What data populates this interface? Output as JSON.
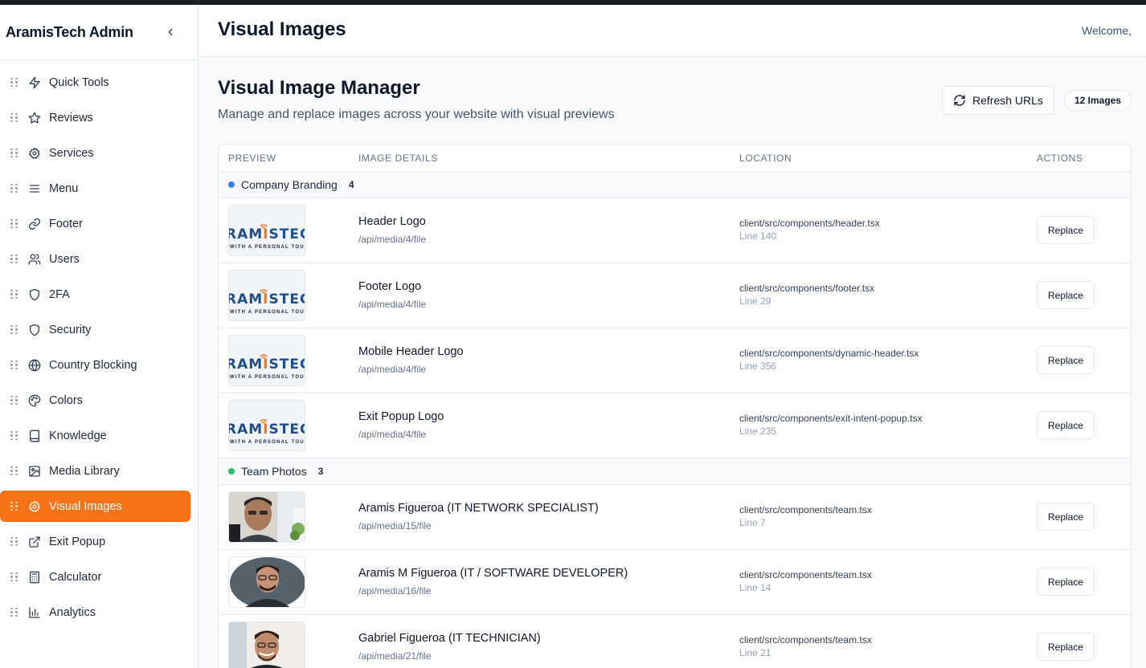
{
  "sidebar": {
    "brand": "AramisTech Admin",
    "collapse_icon": "chevron-left-icon",
    "items": [
      {
        "label": "Quick Tools",
        "icon": "zap-icon"
      },
      {
        "label": "Reviews",
        "icon": "star-icon"
      },
      {
        "label": "Services",
        "icon": "gear-icon"
      },
      {
        "label": "Menu",
        "icon": "menu-icon"
      },
      {
        "label": "Footer",
        "icon": "link-icon"
      },
      {
        "label": "Users",
        "icon": "users-icon"
      },
      {
        "label": "2FA",
        "icon": "shield-icon"
      },
      {
        "label": "Security",
        "icon": "shield-icon"
      },
      {
        "label": "Country Blocking",
        "icon": "globe-icon"
      },
      {
        "label": "Colors",
        "icon": "palette-icon"
      },
      {
        "label": "Knowledge",
        "icon": "book-icon"
      },
      {
        "label": "Media Library",
        "icon": "image-icon"
      },
      {
        "label": "Visual Images",
        "icon": "gear-icon",
        "active": true
      },
      {
        "label": "Exit Popup",
        "icon": "external-link-icon"
      },
      {
        "label": "Calculator",
        "icon": "calculator-icon"
      },
      {
        "label": "Analytics",
        "icon": "bar-chart-icon"
      }
    ]
  },
  "header": {
    "title": "Visual Images",
    "welcome": "Welcome,"
  },
  "main": {
    "title": "Visual Image Manager",
    "subtitle": "Manage and replace images across your website with visual previews",
    "refresh_label": "Refresh URLs",
    "count_badge": "12 Images"
  },
  "table": {
    "columns": [
      "PREVIEW",
      "IMAGE DETAILS",
      "LOCATION",
      "ACTIONS"
    ],
    "groups": [
      {
        "name": "Company Branding",
        "count": "4",
        "dot_color": "#3b82f6",
        "rows": [
          {
            "name": "Header Logo",
            "url": "/api/media/4/file",
            "path": "client/src/components/header.tsx",
            "line": "Line 140",
            "action": "Replace",
            "preview": "logo"
          },
          {
            "name": "Footer Logo",
            "url": "/api/media/4/file",
            "path": "client/src/components/footer.tsx",
            "line": "Line 29",
            "action": "Replace",
            "preview": "logo"
          },
          {
            "name": "Mobile Header Logo",
            "url": "/api/media/4/file",
            "path": "client/src/components/dynamic-header.tsx",
            "line": "Line 356",
            "action": "Replace",
            "preview": "logo"
          },
          {
            "name": "Exit Popup Logo",
            "url": "/api/media/4/file",
            "path": "client/src/components/exit-intent-popup.tsx",
            "line": "Line 235",
            "action": "Replace",
            "preview": "logo"
          }
        ]
      },
      {
        "name": "Team Photos",
        "count": "3",
        "dot_color": "#22c55e",
        "rows": [
          {
            "name": "Aramis Figueroa (IT NETWORK SPECIALIST)",
            "url": "/api/media/15/file",
            "path": "client/src/components/team.tsx",
            "line": "Line 7",
            "action": "Replace",
            "preview": "photo-1"
          },
          {
            "name": "Aramis M Figueroa (IT / SOFTWARE DEVELOPER)",
            "url": "/api/media/16/file",
            "path": "client/src/components/team.tsx",
            "line": "Line 14",
            "action": "Replace",
            "preview": "photo-2"
          },
          {
            "name": "Gabriel Figueroa (IT TECHNICIAN)",
            "url": "/api/media/21/file",
            "path": "client/src/components/team.tsx",
            "line": "Line 21",
            "action": "Replace",
            "preview": "photo-3"
          }
        ]
      }
    ],
    "logo_preview": {
      "text_a": "RAM",
      "text_b": "I",
      "text_c": "STECH",
      "tagline": "WITH A PERSONAL TOUCH"
    }
  },
  "colors": {
    "accent": "#f97316",
    "brand_blue": "#1e4e8c"
  }
}
